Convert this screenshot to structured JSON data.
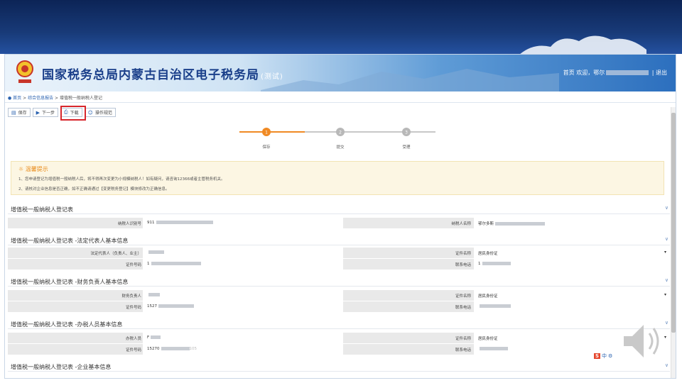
{
  "header": {
    "title": "国家税务总局内蒙古自治区电子税务局",
    "title_suffix": "(测试)",
    "nav": {
      "home": "首页",
      "welcome": "欢迎，鄂尔",
      "sep": "|",
      "logout": "退出"
    }
  },
  "breadcrumb": {
    "home": "首页",
    "sep1": ">",
    "item1": "综合信息报告",
    "sep2": ">",
    "current": "增值税一般纳税人登记"
  },
  "toolbar": {
    "save": "保存",
    "next": "下一步",
    "download": "下载",
    "guide": "操作规范"
  },
  "steps": [
    {
      "label": "保存",
      "num": "1",
      "active": true
    },
    {
      "label": "提交",
      "num": "2",
      "active": false
    },
    {
      "label": "受理",
      "num": "3",
      "active": false
    }
  ],
  "notice": {
    "title": "温馨提示",
    "line1": "1、您申请登记为增值税一般纳税人后，将不得再次变更为小规模纳税人！如有疑问，请咨询12366或者主管税务机关。",
    "line2": "2、请核对企业信息是否正确，如不正确请通过【变更税务登记】模块修改为正确信息。"
  },
  "sections": {
    "main": {
      "title": "增值税一般纳税人登记表",
      "taxid_label": "纳税人识别号",
      "taxid_value": "911",
      "name_label": "纳税人名称",
      "name_value": "鄂尔多斯"
    },
    "legal": {
      "title": "增值税一般纳税人登记表 -法定代表人基本信息",
      "rep_label": "法定代表人（负责人、业主）",
      "idtype_label": "证件名称",
      "idtype_value": "居民身份证",
      "idno_label": "证件号码",
      "idno_value": "1",
      "phone_label": "联系电话",
      "phone_value": "1"
    },
    "finance": {
      "title": "增值税一般纳税人登记表 -财务负责人基本信息",
      "person_label": "财务负责人",
      "idtype_label": "证件名称",
      "idtype_value": "居民身份证",
      "idno_label": "证件号码",
      "idno_value": "1527",
      "phone_label": "联系电话"
    },
    "agent": {
      "title": "增值税一般纳税人登记表 -办税人员基本信息",
      "person_label": "办税人员",
      "person_value": "F",
      "idtype_label": "证件名称",
      "idtype_value": "居民身份证",
      "idno_label": "证件号码",
      "idno_value": "15270",
      "idno_tail": "105",
      "phone_label": "联系电话"
    },
    "company": {
      "title": "增值税一般纳税人登记表 -企业基本信息"
    }
  },
  "ime": {
    "s": "S",
    "zh": "中"
  },
  "colors": {
    "accent": "#2a62b0",
    "step_active": "#f08a24",
    "step_inactive": "#b8b8b8",
    "highlight": "#d7262c",
    "notice_bg": "#fcf6e3"
  }
}
